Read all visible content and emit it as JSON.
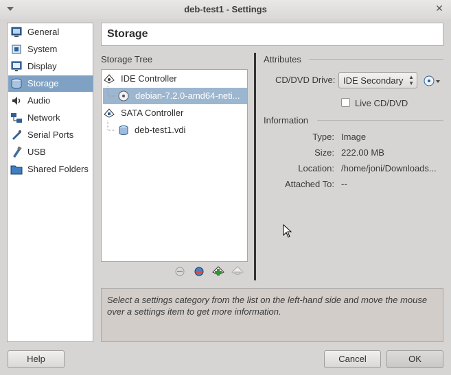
{
  "window": {
    "title": "deb-test1 - Settings"
  },
  "sidebar": {
    "items": [
      {
        "label": "General",
        "icon": "monitor-icon"
      },
      {
        "label": "System",
        "icon": "chip-icon"
      },
      {
        "label": "Display",
        "icon": "display-icon"
      },
      {
        "label": "Storage",
        "icon": "disk-icon",
        "selected": true
      },
      {
        "label": "Audio",
        "icon": "audio-icon"
      },
      {
        "label": "Network",
        "icon": "network-icon"
      },
      {
        "label": "Serial Ports",
        "icon": "serial-port-icon"
      },
      {
        "label": "USB",
        "icon": "usb-icon"
      },
      {
        "label": "Shared Folders",
        "icon": "folder-icon"
      }
    ]
  },
  "page": {
    "title": "Storage"
  },
  "storage_tree": {
    "label": "Storage Tree",
    "items": [
      {
        "label": "IDE Controller",
        "type": "controller",
        "icon": "ide-controller-icon"
      },
      {
        "label": "debian-7.2.0-amd64-neti...",
        "type": "optical",
        "icon": "cd-icon",
        "selected": true
      },
      {
        "label": "SATA Controller",
        "type": "controller",
        "icon": "sata-controller-icon"
      },
      {
        "label": "deb-test1.vdi",
        "type": "disk",
        "icon": "hard-disk-icon"
      }
    ]
  },
  "attributes": {
    "label": "Attributes",
    "drive_label": "CD/DVD Drive:",
    "drive_value": "IDE Secondary",
    "live_label": "Live CD/DVD",
    "live_checked": false
  },
  "information": {
    "label": "Information",
    "rows": [
      {
        "label": "Type:",
        "value": "Image"
      },
      {
        "label": "Size:",
        "value": "222.00 MB"
      },
      {
        "label": "Location:",
        "value": "/home/joni/Downloads..."
      },
      {
        "label": "Attached To:",
        "value": "--"
      }
    ]
  },
  "hint": "Select a settings category from the list on the left-hand side and move the mouse over a settings item to get more information.",
  "buttons": {
    "help": "Help",
    "cancel": "Cancel",
    "ok": "OK"
  },
  "colors": {
    "selection": "#7fa2c4",
    "tree_selection": "#9db6cf",
    "hint_bg": "#d2cdc9"
  }
}
